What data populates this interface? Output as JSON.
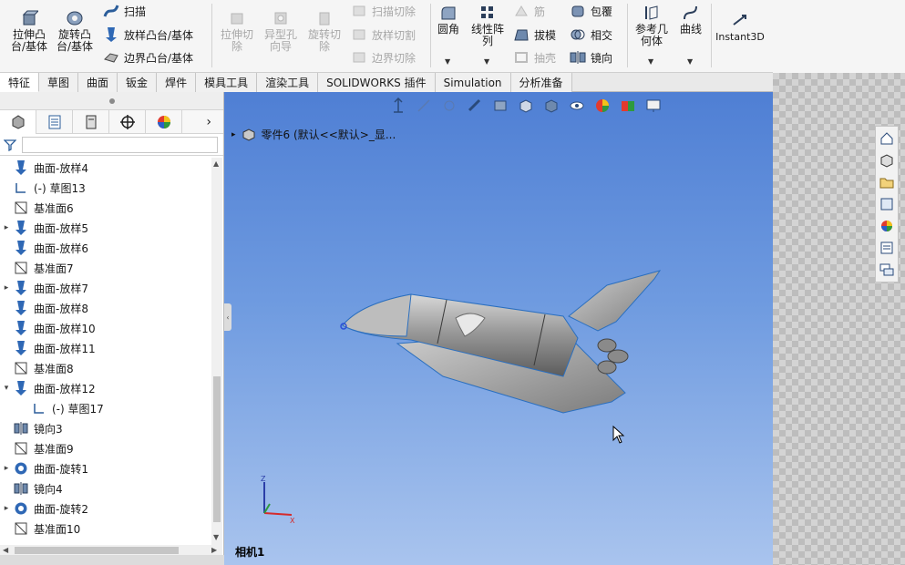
{
  "ribbon": {
    "extrude_boss": "拉伸凸\n台/基体",
    "revolve_boss": "旋转凸\n台/基体",
    "sweep": "扫描",
    "loft_boss": "放样凸台/基体",
    "boundary_boss": "边界凸台/基体",
    "extrude_cut": "拉伸切\n除",
    "hole_wizard": "异型孔\n向导",
    "revolve_cut": "旋转切\n除",
    "swept_cut": "扫描切除",
    "lofted_cut": "放样切割",
    "boundary_cut": "边界切除",
    "fillet": "圆角",
    "linear_pattern": "线性阵\n列",
    "rib": "筋",
    "draft": "拔模",
    "shell": "抽壳",
    "wrap": "包覆",
    "intersect": "相交",
    "mirror": "镜向",
    "reference_geometry": "参考几\n何体",
    "curves": "曲线",
    "instant3d": "Instant3D"
  },
  "tabs": [
    "特征",
    "草图",
    "曲面",
    "钣金",
    "焊件",
    "模具工具",
    "渲染工具",
    "SOLIDWORKS 插件",
    "Simulation",
    "分析准备"
  ],
  "active_tab": "特征",
  "tree": {
    "part_label": "零件6 (默认<<默认>_显...",
    "items": [
      {
        "label": "曲面-放样4",
        "icon": "loft-surface-icon",
        "expand": ""
      },
      {
        "label": "(-) 草图13",
        "icon": "sketch-icon",
        "expand": ""
      },
      {
        "label": "基准面6",
        "icon": "plane-icon",
        "expand": ""
      },
      {
        "label": "曲面-放样5",
        "icon": "loft-surface-icon",
        "expand": "▸"
      },
      {
        "label": "曲面-放样6",
        "icon": "loft-surface-icon",
        "expand": ""
      },
      {
        "label": "基准面7",
        "icon": "plane-icon",
        "expand": ""
      },
      {
        "label": "曲面-放样7",
        "icon": "loft-surface-icon",
        "expand": "▸"
      },
      {
        "label": "曲面-放样8",
        "icon": "loft-surface-icon",
        "expand": ""
      },
      {
        "label": "曲面-放样10",
        "icon": "loft-surface-icon",
        "expand": ""
      },
      {
        "label": "曲面-放样11",
        "icon": "loft-surface-icon",
        "expand": ""
      },
      {
        "label": "基准面8",
        "icon": "plane-icon",
        "expand": ""
      },
      {
        "label": "曲面-放样12",
        "icon": "loft-surface-icon",
        "expand": "▾"
      },
      {
        "label": "(-) 草图17",
        "icon": "sketch-icon",
        "expand": "",
        "indent": true
      },
      {
        "label": "镜向3",
        "icon": "mirror-icon",
        "expand": ""
      },
      {
        "label": "基准面9",
        "icon": "plane-icon",
        "expand": ""
      },
      {
        "label": "曲面-旋转1",
        "icon": "revolve-surface-icon",
        "expand": "▸"
      },
      {
        "label": "镜向4",
        "icon": "mirror-icon",
        "expand": ""
      },
      {
        "label": "曲面-旋转2",
        "icon": "revolve-surface-icon",
        "expand": "▸"
      },
      {
        "label": "基准面10",
        "icon": "plane-icon",
        "expand": ""
      }
    ]
  },
  "viewport": {
    "camera_label": "相机1"
  },
  "colors": {
    "accent": "#2f6fd6",
    "surface": "#9e9e9e",
    "viewport_top": "#4f7fd4",
    "viewport_bottom": "#a9c4ee"
  }
}
